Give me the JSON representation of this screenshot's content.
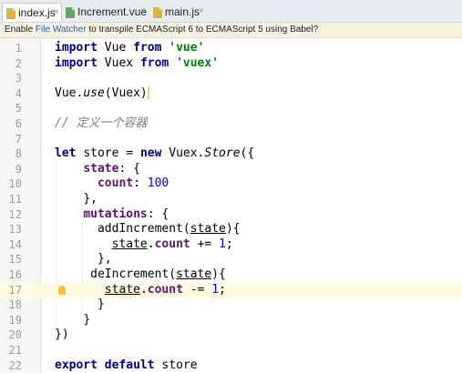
{
  "tabs": [
    {
      "label": "index.js",
      "active": true
    },
    {
      "label": "Increment.vue",
      "active": false
    },
    {
      "label": "main.js",
      "active": false
    }
  ],
  "banner": {
    "pre": "Enable ",
    "link": "File Watcher",
    "post": " to transpile ECMAScript 6 to ECMAScript 5 using Babel?"
  },
  "lines": [
    {
      "n": "1"
    },
    {
      "n": "2"
    },
    {
      "n": "3"
    },
    {
      "n": "4"
    },
    {
      "n": "5"
    },
    {
      "n": "6"
    },
    {
      "n": "7"
    },
    {
      "n": "8"
    },
    {
      "n": "9"
    },
    {
      "n": "10"
    },
    {
      "n": "11"
    },
    {
      "n": "12"
    },
    {
      "n": "13"
    },
    {
      "n": "14"
    },
    {
      "n": "15"
    },
    {
      "n": "16"
    },
    {
      "n": "17"
    },
    {
      "n": "18"
    },
    {
      "n": "19"
    },
    {
      "n": "20"
    },
    {
      "n": "21"
    },
    {
      "n": "22"
    }
  ],
  "code": {
    "import": "import",
    "from": "from",
    "vue_id": "Vue",
    "vue_str": "'vue'",
    "vuex_id": "Vuex",
    "vuex_str": "'vuex'",
    "vue_use_obj": "Vue.",
    "vue_use_fn": "use",
    "vue_use_arg": "(Vuex)",
    "comment": "// 定义一个容器",
    "let": "let",
    "store": "store",
    "eq": "=",
    "new": "new",
    "vuex_dot": "Vuex.",
    "Store": "Store",
    "open_obj": "({",
    "state_key": "state",
    "colon_brace": ": {",
    "count_key": "count",
    "colon": ":",
    "count_val": "100",
    "close_comma": "},",
    "mutations_key": "mutations",
    "addIncrement": "addIncrement",
    "deIncrement": "deIncrement",
    "paren_open": "(",
    "state_param": "state",
    "paren_close_brace": "){",
    "state_ref": "state",
    "dot_count": ".count",
    "plus_eq": "+=",
    "minus_eq": "-=",
    "one": "1",
    "semi": ";",
    "close_brace": "}",
    "close_paren": "})",
    "export": "export",
    "default": "default"
  }
}
